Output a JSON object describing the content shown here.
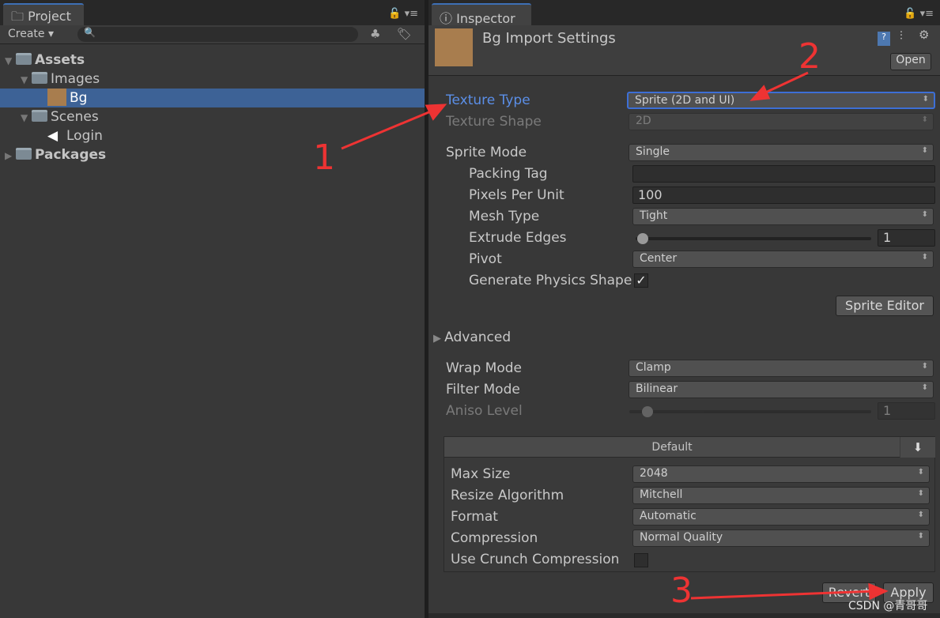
{
  "project": {
    "tab": "Project",
    "create": "Create ▾",
    "search_placeholder": "",
    "tree": [
      {
        "label": "Assets",
        "bold": true,
        "indent": 0,
        "arrow": "▼",
        "icon": "folder"
      },
      {
        "label": "Images",
        "indent": 1,
        "arrow": "▼",
        "icon": "folder"
      },
      {
        "label": "Bg",
        "indent": 2,
        "arrow": "",
        "icon": "texture",
        "selected": true
      },
      {
        "label": "Scenes",
        "indent": 1,
        "arrow": "▼",
        "icon": "folder"
      },
      {
        "label": "Login",
        "indent": 2,
        "arrow": "",
        "icon": "unity-scene"
      },
      {
        "label": "Packages",
        "bold": true,
        "indent": 0,
        "arrow": "▶",
        "icon": "folder"
      }
    ]
  },
  "inspector": {
    "tab": "Inspector",
    "title": "Bg Import Settings",
    "open": "Open",
    "texture_type": {
      "label": "Texture Type",
      "value": "Sprite (2D and UI)"
    },
    "texture_shape": {
      "label": "Texture Shape",
      "value": "2D"
    },
    "sprite_mode": {
      "label": "Sprite Mode",
      "value": "Single"
    },
    "packing_tag": {
      "label": "Packing Tag",
      "value": ""
    },
    "ppu": {
      "label": "Pixels Per Unit",
      "value": "100"
    },
    "mesh_type": {
      "label": "Mesh Type",
      "value": "Tight"
    },
    "extrude": {
      "label": "Extrude Edges",
      "value": "1"
    },
    "pivot": {
      "label": "Pivot",
      "value": "Center"
    },
    "physics": {
      "label": "Generate Physics Shape",
      "checked": true
    },
    "sprite_editor": "Sprite Editor",
    "advanced": "Advanced",
    "wrap": {
      "label": "Wrap Mode",
      "value": "Clamp"
    },
    "filter": {
      "label": "Filter Mode",
      "value": "Bilinear"
    },
    "aniso": {
      "label": "Aniso Level",
      "value": "1"
    },
    "platform": {
      "tab": "Default",
      "max_size": {
        "label": "Max Size",
        "value": "2048"
      },
      "resize": {
        "label": "Resize Algorithm",
        "value": "Mitchell"
      },
      "format": {
        "label": "Format",
        "value": "Automatic"
      },
      "compression": {
        "label": "Compression",
        "value": "Normal Quality"
      },
      "crunch": {
        "label": "Use Crunch Compression",
        "checked": false
      }
    },
    "revert": "Revert",
    "apply": "Apply"
  },
  "annotations": {
    "n1": "1",
    "n2": "2",
    "n3": "3",
    "color": "#ee3333"
  },
  "watermark": "CSDN @青哥哥"
}
